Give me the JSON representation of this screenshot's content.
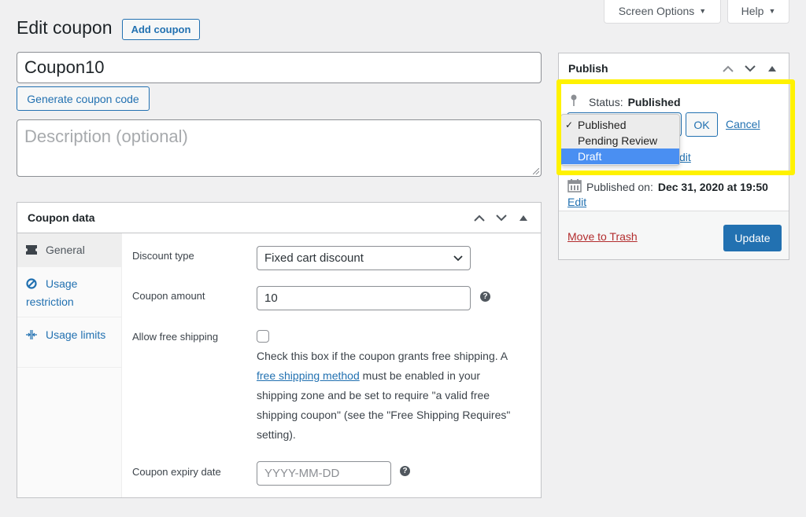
{
  "header": {
    "screen_options_label": "Screen Options",
    "help_label": "Help",
    "page_title": "Edit coupon",
    "add_coupon_label": "Add coupon"
  },
  "coupon": {
    "code": "Coupon10",
    "generate_label": "Generate coupon code",
    "description_placeholder": "Description (optional)",
    "description_value": ""
  },
  "coupon_data": {
    "title": "Coupon data",
    "tabs": [
      {
        "label": "General",
        "icon": "ticket-icon",
        "active": true
      },
      {
        "label": "Usage restriction",
        "icon": "block-icon",
        "active": false
      },
      {
        "label": "Usage limits",
        "icon": "limits-icon",
        "active": false
      }
    ],
    "fields": {
      "discount_type_label": "Discount type",
      "discount_type_value": "Fixed cart discount",
      "amount_label": "Coupon amount",
      "amount_value": "10",
      "free_shipping_label": "Allow free shipping",
      "free_shipping_checked": false,
      "free_shipping_desc_1": "Check this box if the coupon grants free shipping. A ",
      "free_shipping_link": "free shipping method",
      "free_shipping_desc_2": " must be enabled in your shipping zone and be set to require \"a valid free shipping coupon\" (see the \"Free Shipping Requires\" setting).",
      "expiry_label": "Coupon expiry date",
      "expiry_placeholder": "YYYY-MM-DD",
      "expiry_value": ""
    }
  },
  "publish": {
    "title": "Publish",
    "status_label": "Status:",
    "status_value": "Published",
    "status_options": [
      {
        "label": "Published",
        "checked": true,
        "highlighted": false
      },
      {
        "label": "Pending Review",
        "checked": false,
        "highlighted": false
      },
      {
        "label": "Draft",
        "checked": false,
        "highlighted": true
      }
    ],
    "ok_label": "OK",
    "cancel_label": "Cancel",
    "visibility_edit_fragment": "dit",
    "published_on_label": "Published on:",
    "published_on_value": "Dec 31, 2020 at 19:50",
    "edit_label": "Edit",
    "trash_label": "Move to Trash",
    "update_label": "Update"
  },
  "colors": {
    "accent": "#2271b1",
    "highlight_frame": "#fff200",
    "dropdown_highlight": "#4a8ff2",
    "trash": "#b32d2e"
  }
}
